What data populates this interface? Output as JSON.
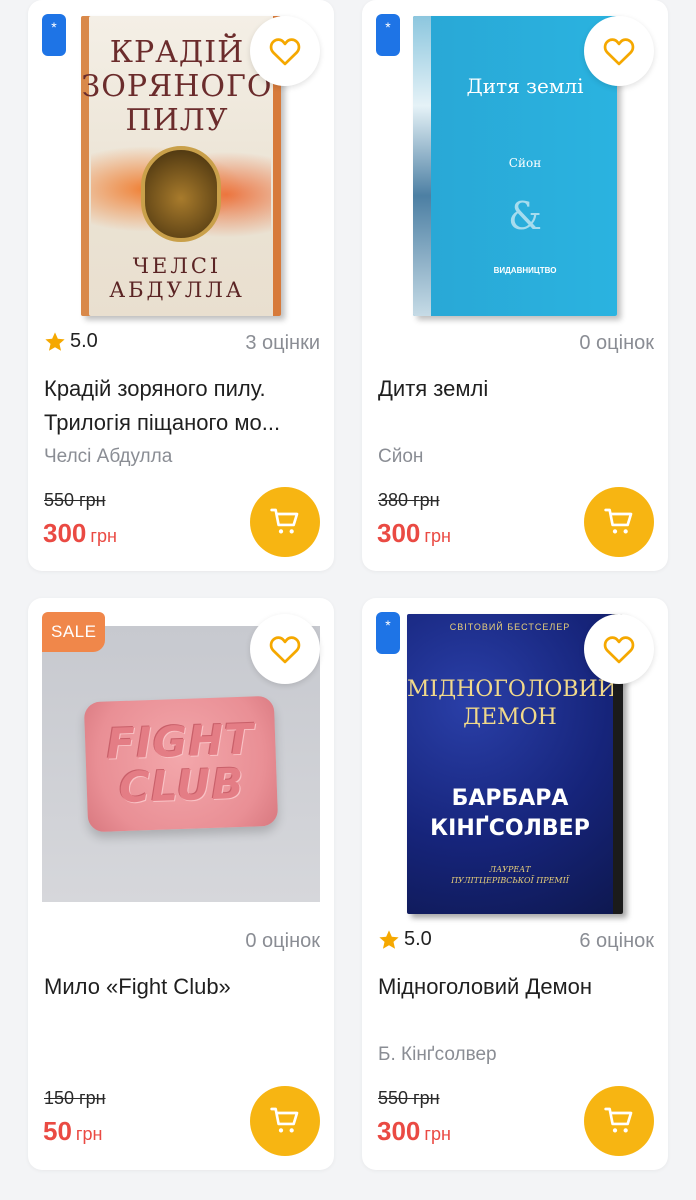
{
  "products": [
    {
      "badge": "*",
      "cover": {
        "title_lines": [
          "КРАДІЙ",
          "ЗОРЯНОГО",
          "ПИЛУ"
        ],
        "author_lines": [
          "ЧЕЛСІ",
          "АБДУЛЛА"
        ]
      },
      "rating": "5.0",
      "reviews": "3 оцінки",
      "title_line1": "Крадій зоряного пилу.",
      "title_line2": "Трилогія піщаного мо...",
      "author": "Челсі Абдулла",
      "old_price": "550 грн",
      "price": "300",
      "currency": "грн"
    },
    {
      "badge": "*",
      "cover": {
        "title": "Дитя землі",
        "author": "Сйон",
        "ampersand": "&",
        "publisher": "ВИДАВНИЦТВО"
      },
      "reviews": "0 оцінок",
      "title_line1": "Дитя землі",
      "title_line2": "",
      "author": "Сйон",
      "old_price": "380 грн",
      "price": "300",
      "currency": "грн"
    },
    {
      "badge": "SALE",
      "soap_text_lines": [
        "FIGHT",
        "CLUB"
      ],
      "reviews": "0 оцінок",
      "title_line1": "Мило «Fight Club»",
      "title_line2": "",
      "author": "",
      "old_price": "150 грн",
      "price": "50",
      "currency": "грн"
    },
    {
      "badge": "*",
      "cover": {
        "top": "СВІТОВИЙ БЕСТСЕЛЕР",
        "title_lines": [
          "МІДНОГОЛОВИЙ",
          "ДЕМОН"
        ],
        "author_lines": [
          "БАРБАРА",
          "КІНҐСОЛВЕР"
        ],
        "sub_lines": [
          "ЛАУРЕАТ",
          "ПУЛІТЦЕРІВСЬКОЇ ПРЕМІЇ"
        ]
      },
      "rating": "5.0",
      "reviews": "6 оцінок",
      "title_line1": "Мідноголовий Демон",
      "title_line2": "",
      "author": "Б. Кінґсолвер",
      "old_price": "550 грн",
      "price": "300",
      "currency": "грн"
    }
  ],
  "icons": {
    "favorite": "heart-icon",
    "cart": "cart-icon",
    "rating": "star-icon"
  },
  "colors": {
    "accent": "#f7b512",
    "price": "#ea4a43",
    "badge_blue": "#1e74e6",
    "badge_sale": "#f0874a",
    "star": "#f5a800"
  }
}
